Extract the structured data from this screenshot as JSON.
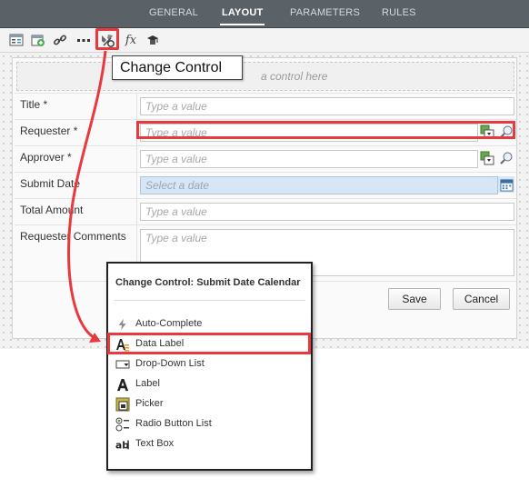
{
  "tabs": [
    {
      "label": "GENERAL"
    },
    {
      "label": "LAYOUT"
    },
    {
      "label": "PARAMETERS"
    },
    {
      "label": "RULES"
    }
  ],
  "toolbar": {
    "icons": [
      "properties-icon",
      "add-edit-icon",
      "link-icon",
      "more-icon",
      "change-control-icon",
      "expression-icon",
      "certificate-icon"
    ]
  },
  "tooltip": {
    "text": "Change Control"
  },
  "dropzone": {
    "text": "a control here"
  },
  "form": {
    "rows": [
      {
        "label": "Title *",
        "placeholder": "Type a value"
      },
      {
        "label": "Requester *",
        "placeholder": "Type a value"
      },
      {
        "label": "Approver *",
        "placeholder": "Type a value"
      },
      {
        "label": "Submit Date",
        "placeholder": "Select a date"
      },
      {
        "label": "Total Amount",
        "placeholder": "Type a value"
      },
      {
        "label": "Requester Comments",
        "placeholder": "Type a value"
      }
    ],
    "save_label": "Save",
    "cancel_label": "Cancel"
  },
  "popup": {
    "title": "Change Control: Submit Date Calendar",
    "items": [
      {
        "label": "Auto-Complete",
        "icon": "lightning-icon"
      },
      {
        "label": "Data Label",
        "icon": "data-label-icon"
      },
      {
        "label": "Drop-Down List",
        "icon": "dropdown-icon"
      },
      {
        "label": "Label",
        "icon": "label-icon"
      },
      {
        "label": "Picker",
        "icon": "picker-icon"
      },
      {
        "label": "Radio Button List",
        "icon": "radio-list-icon"
      },
      {
        "label": "Text Box",
        "icon": "text-box-icon"
      }
    ]
  },
  "colors": {
    "highlight": "#e8393f",
    "tabbar": "#5a6268",
    "date_field": "#d6e6f4"
  }
}
